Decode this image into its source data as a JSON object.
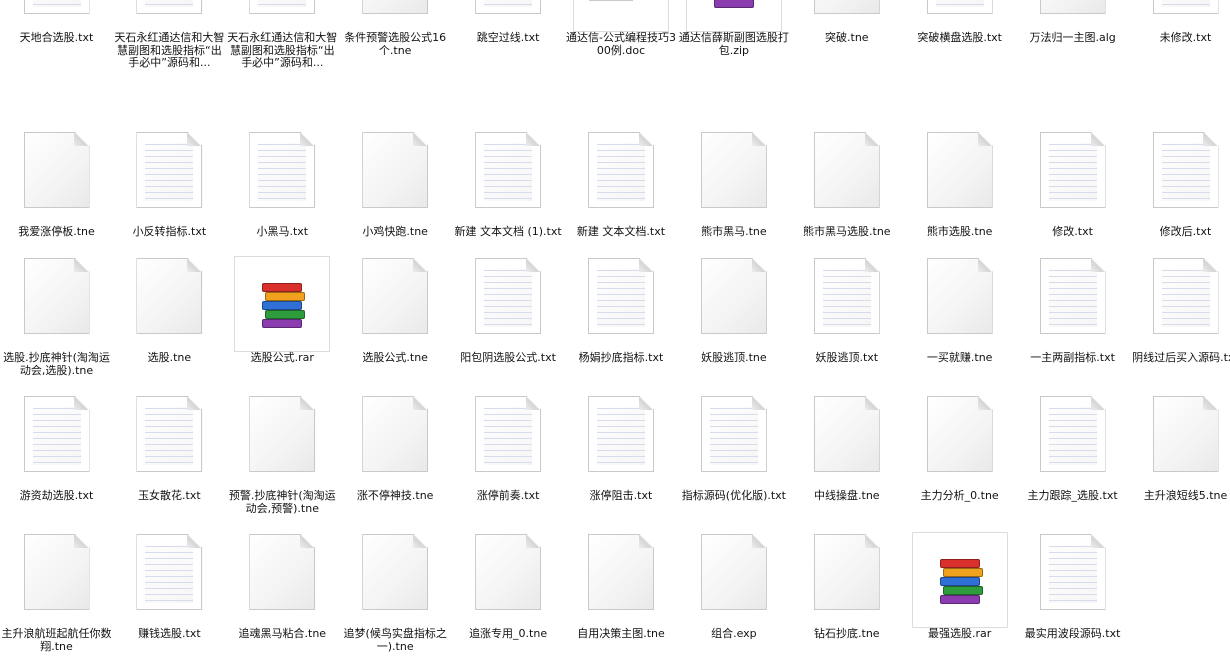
{
  "files": [
    {
      "name": "天地合选股.txt",
      "icon": "text-file-icon"
    },
    {
      "name": "天石永红通达信和大智慧副图和选股指标“出手必中”源码和...",
      "icon": "text-file-icon"
    },
    {
      "name": "天石永红通达信和大智慧副图和选股指标“出手必中”源码和...",
      "icon": "text-file-icon"
    },
    {
      "name": "条件预警选股公式16个.tne",
      "icon": "blank-file-icon"
    },
    {
      "name": "跳空过线.txt",
      "icon": "text-file-icon"
    },
    {
      "name": "通达信-公式编程技巧300例.doc",
      "icon": "word-doc-icon"
    },
    {
      "name": "通达信薛斯副图选股打包.zip",
      "icon": "winrar-archive-icon"
    },
    {
      "name": "突破.tne",
      "icon": "blank-file-icon"
    },
    {
      "name": "突破横盘选股.txt",
      "icon": "text-file-icon"
    },
    {
      "name": "万法归一主图.alg",
      "icon": "blank-file-icon"
    },
    {
      "name": "未修改.txt",
      "icon": "text-file-icon"
    },
    {
      "name": "我爱涨停板.tne",
      "icon": "blank-file-icon"
    },
    {
      "name": "小反转指标.txt",
      "icon": "text-file-icon"
    },
    {
      "name": "小黑马.txt",
      "icon": "text-file-icon"
    },
    {
      "name": "小鸡快跑.tne",
      "icon": "blank-file-icon"
    },
    {
      "name": "新建 文本文档 (1).txt",
      "icon": "text-file-icon"
    },
    {
      "name": "新建 文本文档.txt",
      "icon": "text-file-icon"
    },
    {
      "name": "熊市黑马.tne",
      "icon": "blank-file-icon"
    },
    {
      "name": "熊市黑马选股.tne",
      "icon": "blank-file-icon"
    },
    {
      "name": "熊市选股.tne",
      "icon": "blank-file-icon"
    },
    {
      "name": "修改.txt",
      "icon": "text-file-icon"
    },
    {
      "name": "修改后.txt",
      "icon": "text-file-icon"
    },
    {
      "name": "选股.抄底神针(淘淘运动会,选股).tne",
      "icon": "blank-file-icon"
    },
    {
      "name": "选股.tne",
      "icon": "blank-file-icon"
    },
    {
      "name": "选股公式.rar",
      "icon": "winrar-archive-icon"
    },
    {
      "name": "选股公式.tne",
      "icon": "blank-file-icon"
    },
    {
      "name": "阳包阴选股公式.txt",
      "icon": "text-file-icon"
    },
    {
      "name": "杨娟抄底指标.txt",
      "icon": "text-file-icon"
    },
    {
      "name": "妖股逃顶.tne",
      "icon": "blank-file-icon"
    },
    {
      "name": "妖股逃顶.txt",
      "icon": "text-file-icon"
    },
    {
      "name": "一买就赚.tne",
      "icon": "blank-file-icon"
    },
    {
      "name": "一主两副指标.txt",
      "icon": "text-file-icon"
    },
    {
      "name": "阴线过后买入源码.txt",
      "icon": "text-file-icon"
    },
    {
      "name": "游资劫选股.txt",
      "icon": "text-file-icon"
    },
    {
      "name": "玉女散花.txt",
      "icon": "text-file-icon"
    },
    {
      "name": "预警.抄底神针(淘淘运动会,预警).tne",
      "icon": "blank-file-icon"
    },
    {
      "name": "涨不停神技.tne",
      "icon": "blank-file-icon"
    },
    {
      "name": "涨停前奏.txt",
      "icon": "text-file-icon"
    },
    {
      "name": "涨停阻击.txt",
      "icon": "text-file-icon"
    },
    {
      "name": "指标源码(优化版).txt",
      "icon": "text-file-icon"
    },
    {
      "name": "中线操盘.tne",
      "icon": "blank-file-icon"
    },
    {
      "name": "主力分析_0.tne",
      "icon": "blank-file-icon"
    },
    {
      "name": "主力跟踪_选股.txt",
      "icon": "text-file-icon"
    },
    {
      "name": "主升浪短线5.tne",
      "icon": "blank-file-icon"
    },
    {
      "name": "主升浪航班起航任你数翔.tne",
      "icon": "blank-file-icon"
    },
    {
      "name": "赚钱选股.txt",
      "icon": "text-file-icon"
    },
    {
      "name": "追魂黑马粘合.tne",
      "icon": "blank-file-icon"
    },
    {
      "name": "追梦(候鸟实盘指标之一).tne",
      "icon": "blank-file-icon"
    },
    {
      "name": "追涨专用_0.tne",
      "icon": "blank-file-icon"
    },
    {
      "name": "自用决策主图.tne",
      "icon": "blank-file-icon"
    },
    {
      "name": "组合.exp",
      "icon": "blank-file-icon"
    },
    {
      "name": "钻石抄底.tne",
      "icon": "blank-file-icon"
    },
    {
      "name": "最强选股.rar",
      "icon": "winrar-archive-icon"
    },
    {
      "name": "最实用波段源码.txt",
      "icon": "text-file-icon"
    }
  ],
  "icon_colors": {
    "book1": "#d9302b",
    "book2": "#2f6fd6",
    "book3": "#f0a11e",
    "book4": "#2e9c3c",
    "book5": "#8b3db0"
  }
}
